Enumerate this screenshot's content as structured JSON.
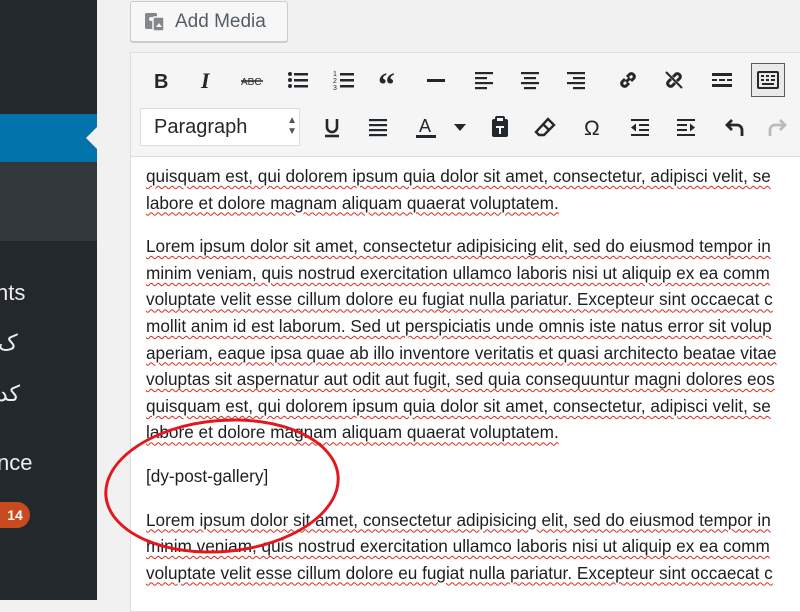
{
  "sidebar": {
    "labels": [
      "nts",
      "ک",
      "کد",
      "nce"
    ],
    "badge": "14"
  },
  "add_media": {
    "label": "Add Media",
    "icon": "media-icon"
  },
  "toolbar": {
    "row1": [
      "bold-icon",
      "italic-icon",
      "strikethrough-icon",
      "bulleted-list-icon",
      "numbered-list-icon",
      "blockquote-icon",
      "horizontal-line-icon",
      "align-left-icon",
      "align-center-icon",
      "align-right-icon",
      "insert-link-icon",
      "remove-link-icon",
      "read-more-tag-icon",
      "toolbar-toggle-icon"
    ],
    "format": "Paragraph",
    "row2": [
      "underline-icon",
      "justify-icon",
      "text-color-icon",
      "color-dropdown-icon",
      "paste-as-text-icon",
      "clear-formatting-icon",
      "special-character-icon",
      "outdent-icon",
      "indent-icon",
      "undo-icon",
      "redo-icon"
    ]
  },
  "content": {
    "p1_line1": "quisquam est, qui dolorem ipsum quia dolor sit amet, consectetur, adipisci velit, se",
    "p1_line2": "labore et dolore magnam aliquam quaerat voluptatem.",
    "p2_lines": [
      "Lorem ipsum dolor sit amet, consectetur adipisicing elit, sed do eiusmod tempor in",
      "minim veniam, quis nostrud exercitation ullamco laboris nisi ut aliquip ex ea comm",
      "voluptate velit esse cillum dolore eu fugiat nulla pariatur. Excepteur sint occaecat c",
      "mollit anim id est laborum. Sed ut perspiciatis unde omnis iste natus error sit volup",
      "aperiam, eaque ipsa quae ab illo inventore veritatis et quasi architecto beatae vitae",
      "voluptas sit aspernatur aut odit aut fugit, sed quia consequuntur magni dolores eos",
      "quisquam est, qui dolorem ipsum quia dolor sit amet, consectetur, adipisci velit, se",
      "labore et dolore magnam aliquam quaerat voluptatem."
    ],
    "shortcode": "[dy-post-gallery]",
    "p3_lines": [
      "Lorem ipsum dolor sit amet, consectetur adipisicing elit, sed do eiusmod tempor in",
      "minim veniam, quis nostrud exercitation ullamco laboris nisi ut aliquip ex ea comm",
      "voluptate velit esse cillum dolore eu fugiat nulla pariatur. Excepteur sint occaecat c"
    ]
  },
  "annotation": {
    "color": "#e3171f"
  },
  "colors": {
    "admin_bg": "#23282d",
    "active": "#0073aa",
    "badge": "#ca4a1f"
  }
}
